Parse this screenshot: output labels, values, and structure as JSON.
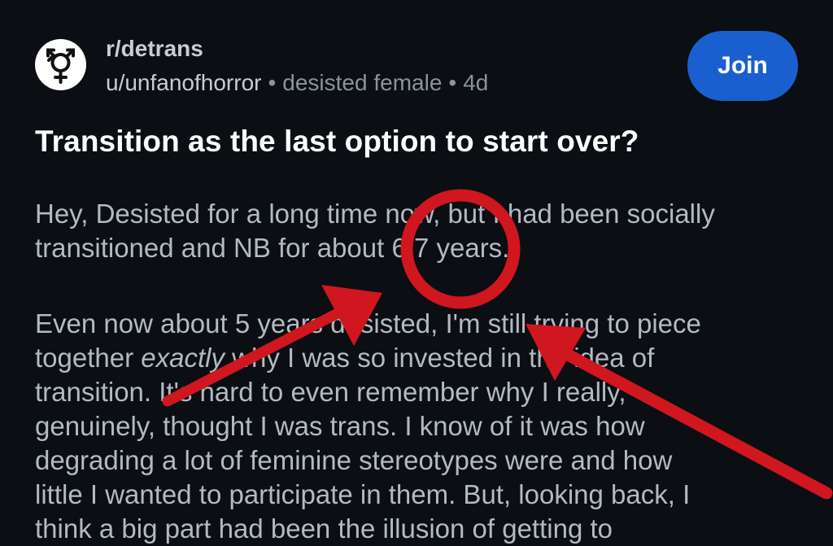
{
  "header": {
    "subreddit": "r/detrans",
    "username": "u/unfanofhorror",
    "separator": "•",
    "flair": "desisted female",
    "age": "4d",
    "join_label": "Join",
    "avatar_icon": "gender-symbol-icon"
  },
  "post": {
    "title": "Transition as the last option to start over?",
    "p1_lines": [
      "Hey, Desisted for a long time now, but I had been socially",
      "transitioned and NB for about 6/7 years."
    ],
    "p2": {
      "line1": "Even now about 5 years desisted, I'm still trying to piece",
      "line2_pre": "together ",
      "line2_em": "exactly",
      "line2_post": " why I was so invested in the idea of",
      "line3": "transition. It's hard to even remember why I really,",
      "line4": "genuinely, thought I was trans. I know of it was how",
      "line5": "degrading a lot of feminine stereotypes were and how",
      "line6": "little I wanted to participate in them. But, looking back, I",
      "line7": "think a big  part had been the illusion of getting to"
    }
  },
  "annotation": {
    "color": "#d0161e",
    "shapes": [
      "circle",
      "arrow",
      "arrow"
    ]
  },
  "colors": {
    "background": "#0b0e12",
    "join_button": "#1a5fcf",
    "title": "#ffffff",
    "body_text": "#b2bac2",
    "meta_text": "#8a939b"
  }
}
